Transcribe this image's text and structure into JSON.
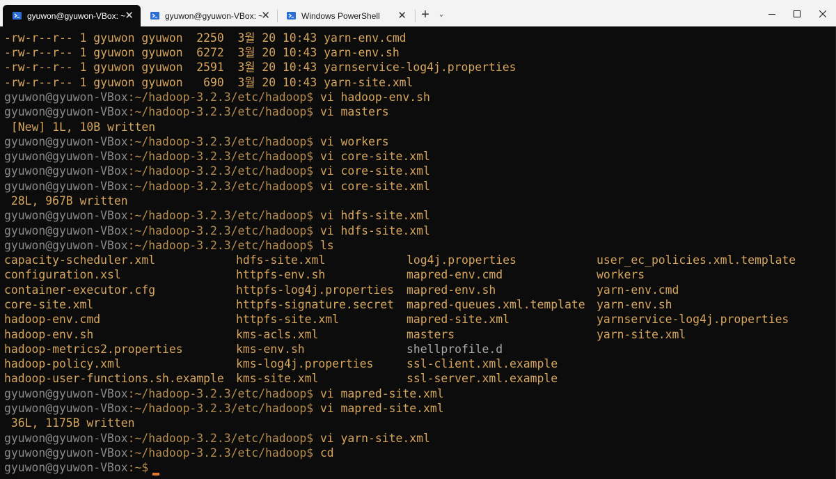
{
  "tabs": [
    {
      "title": "gyuwon@gyuwon-VBox: ~",
      "active": true,
      "icon": "powershell-prompt-icon"
    },
    {
      "title": "gyuwon@gyuwon-VBox: ~/da",
      "active": false,
      "icon": "powershell-prompt-icon"
    },
    {
      "title": "Windows PowerShell",
      "active": false,
      "icon": "powershell-prompt-icon"
    }
  ],
  "tabbar": {
    "new_tab": "+",
    "dropdown": "⌄",
    "close": "✕"
  },
  "window": {
    "minimize": "—",
    "maximize": "☐",
    "close": "✕"
  },
  "colors": {
    "accent_text": "#cc9f5e",
    "prompt_user": "#8a8a8a",
    "cursor": "#e2762b",
    "background": "#0c0c0c"
  },
  "terminal": {
    "prompt_user": "gyuwon@gyuwon-VBox",
    "prompt_path": ":~/hadoop-3.2.3/etc/hadoop$",
    "home_path": ":~$",
    "file_lines": [
      "-rw-r--r-- 1 gyuwon gyuwon  2250  3월 20 10:43 yarn-env.cmd",
      "-rw-r--r-- 1 gyuwon gyuwon  6272  3월 20 10:43 yarn-env.sh",
      "-rw-r--r-- 1 gyuwon gyuwon  2591  3월 20 10:43 yarnservice-log4j.properties",
      "-rw-r--r-- 1 gyuwon gyuwon   690  3월 20 10:43 yarn-site.xml"
    ],
    "commands_1": [
      "vi hadoop-env.sh",
      "vi masters"
    ],
    "msg_1": " [New] 1L, 10B written",
    "commands_2": [
      "vi workers",
      "vi core-site.xml",
      "vi core-site.xml",
      "vi core-site.xml"
    ],
    "msg_2": " 28L, 967B written",
    "commands_3": [
      "vi hdfs-site.xml",
      "vi hdfs-site.xml",
      "ls"
    ],
    "ls_columns": [
      [
        "capacity-scheduler.xml",
        "configuration.xsl",
        "container-executor.cfg",
        "core-site.xml",
        "hadoop-env.cmd",
        "hadoop-env.sh",
        "hadoop-metrics2.properties",
        "hadoop-policy.xml",
        "hadoop-user-functions.sh.example"
      ],
      [
        "hdfs-site.xml",
        "httpfs-env.sh",
        "httpfs-log4j.properties",
        "httpfs-signature.secret",
        "httpfs-site.xml",
        "kms-acls.xml",
        "kms-env.sh",
        "kms-log4j.properties",
        "kms-site.xml"
      ],
      [
        "log4j.properties",
        "mapred-env.cmd",
        "mapred-env.sh",
        "mapred-queues.xml.template",
        "mapred-site.xml",
        "masters",
        "shellprofile.d",
        "ssl-client.xml.example",
        "ssl-server.xml.example"
      ],
      [
        "user_ec_policies.xml.template",
        "workers",
        "yarn-env.cmd",
        "yarn-env.sh",
        "yarnservice-log4j.properties",
        "yarn-site.xml"
      ]
    ],
    "commands_4": [
      "vi mapred-site.xml",
      "vi mapred-site.xml"
    ],
    "msg_3": " 36L, 1175B written",
    "commands_5": [
      "vi yarn-site.xml",
      "cd"
    ]
  }
}
